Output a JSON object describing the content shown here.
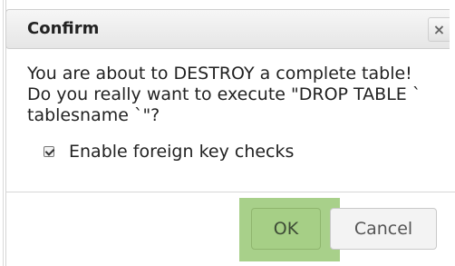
{
  "dialog": {
    "title": "Confirm",
    "close_icon": "×",
    "message": "You are about to DESTROY a complete table! Do you really want to execute \"DROP TABLE ` tablesname `\"?",
    "checkbox_label": "Enable foreign key checks",
    "ok_label": "OK",
    "cancel_label": "Cancel"
  },
  "colors": {
    "ok_highlight": "#a8d08a",
    "dialog_border": "#cfcfcf"
  }
}
